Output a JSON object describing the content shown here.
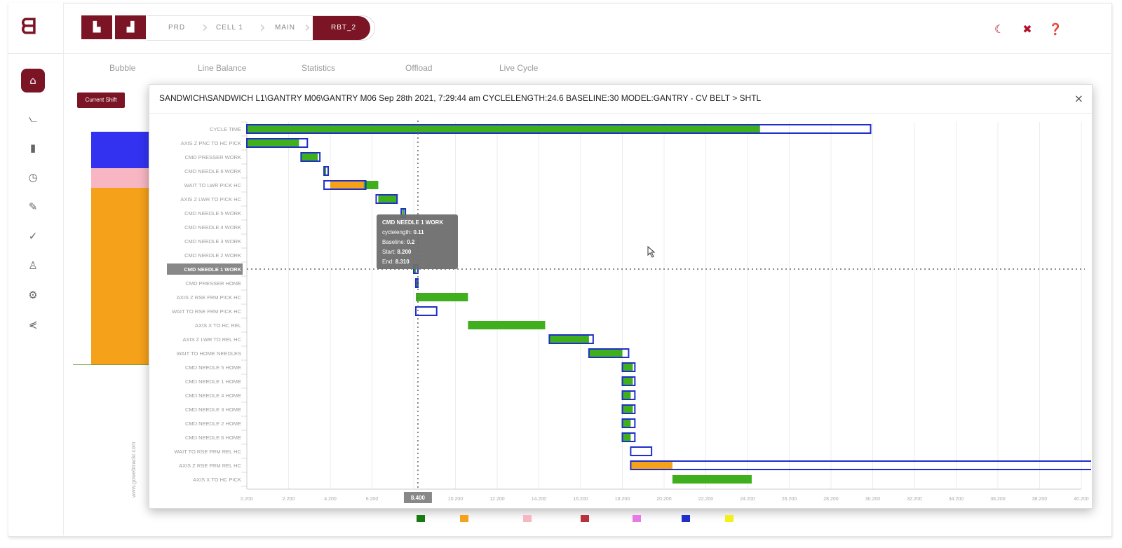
{
  "breadcrumb": {
    "items": [
      "PRD",
      "CELL 1",
      "MAIN",
      "RBT_2"
    ]
  },
  "toolbar": {
    "btn1_icon": "factory-icon",
    "btn2_icon": "chart-bar-icon"
  },
  "top_icons": [
    "moon-icon",
    "fullscreen-icon",
    "help-icon"
  ],
  "tabs": [
    "Bubble",
    "Line Balance",
    "Statistics",
    "Offload",
    "Live Cycle"
  ],
  "current_shift_label": "Current Shift",
  "side_icons": [
    "home-icon",
    "rss-icon",
    "signal-icon",
    "clock-icon",
    "edit-icon",
    "check-circle-icon",
    "user-icon",
    "settings-icon",
    "share-icon"
  ],
  "background_chart": {
    "vertical_label": "www.gowebtrackr.com"
  },
  "modal": {
    "title": "SANDWICH\\SANDWICH L1\\GANTRY M06\\GANTRY M06 Sep 28th 2021, 7:29:44 am CYCLELENGTH:24.6 BASELINE:30 MODEL:GANTRY - CV BELT > SHTL",
    "close": "×"
  },
  "tooltip": {
    "title": "CMD NEEDLE 1 WORK",
    "lines": [
      "cyclelength: 0.11",
      "Baseline: 0.2",
      "Start: 8.200",
      "End: 8.310"
    ]
  },
  "colors": {
    "green": "#3faf1e",
    "orange": "#f5a11a",
    "blue": "#1f2fc8",
    "pink": "#f7b6c2",
    "brown": "#b8323e",
    "violet": "#e57ae4",
    "yellow": "#f5f01a",
    "darkgreen": "#1a7a12",
    "brand": "#7b1424"
  },
  "legend_colors": [
    "#1a7a12",
    "#f5a11a",
    "#f7b6c2",
    "#b8323e",
    "#e57ae4",
    "#1f2fc8",
    "#f5f01a"
  ],
  "chart_data": {
    "type": "gantt",
    "title": "",
    "xlim": [
      0.2,
      40.2
    ],
    "x_ticks": [
      "0.200",
      "2.200",
      "4.200",
      "6.200",
      "8.200",
      "10.200",
      "12.200",
      "14.200",
      "16.200",
      "18.200",
      "20.200",
      "22.200",
      "24.200",
      "26.200",
      "28.200",
      "30.200",
      "32.200",
      "34.200",
      "36.200",
      "38.200",
      "40.200"
    ],
    "crosshair_x_label": "8.400",
    "crosshair_category": "CMD NEEDLE 1 WORK",
    "categories": [
      "CYCLE TIME",
      "AXIS Z PNC TO HC PICK",
      "CMD PRESSER WORK",
      "CMD NEEDLE 6 WORK",
      "WAIT TO LWR PICK HC",
      "AXIS Z LWR TO PICK HC",
      "CMD NEEDLE 5 WORK",
      "CMD NEEDLE 4 WORK",
      "CMD NEEDLE 3 WORK",
      "CMD NEEDLE 2 WORK",
      "CMD NEEDLE 1 WORK",
      "CMD PRESSER HOME",
      "AXIS Z RSE FRM PICK HC",
      "WAIT TO RSE FRM PICK HC",
      "AXIS X TO HC REL",
      "AXIS Z LWR TO REL HC",
      "WAIT TO HOME NEEDLES",
      "CMD NEEDLE 5 HOME",
      "CMD NEEDLE 1 HOME",
      "CMD NEEDLE 4 HOME",
      "CMD NEEDLE 3 HOME",
      "CMD NEEDLE 2 HOME",
      "CMD NEEDLE 6 HOME",
      "WAIT TO RSE FRM REL HC",
      "AXIS Z RSE FRM REL HC",
      "AXIS X TO HC PICK"
    ],
    "series": [
      {
        "name": "cyclelength",
        "color": "green",
        "bars": [
          [
            0,
            0.2,
            24.8
          ],
          [
            1,
            0.2,
            2.7
          ],
          [
            2,
            2.8,
            3.6
          ],
          [
            3,
            3.9,
            4.0
          ],
          [
            4,
            4.2,
            5.8
          ],
          [
            4,
            5.8,
            6.5
          ],
          [
            5,
            6.5,
            7.4
          ],
          [
            6,
            7.65,
            7.75
          ],
          [
            10,
            8.2,
            8.31
          ],
          [
            11,
            8.3,
            8.35
          ],
          [
            12,
            8.3,
            10.8
          ],
          [
            14,
            10.8,
            14.5
          ],
          [
            15,
            14.7,
            16.6
          ],
          [
            16,
            16.6,
            18.2
          ],
          [
            17,
            18.2,
            18.7
          ],
          [
            18,
            18.2,
            18.7
          ],
          [
            19,
            18.2,
            18.6
          ],
          [
            20,
            18.2,
            18.7
          ],
          [
            21,
            18.2,
            18.6
          ],
          [
            22,
            18.2,
            18.6
          ],
          [
            24,
            18.6,
            20.6
          ],
          [
            25,
            20.6,
            24.4
          ]
        ]
      },
      {
        "name": "Baseline",
        "color": "blue",
        "bars": [
          [
            0,
            0.2,
            30.1
          ],
          [
            1,
            0.2,
            3.1
          ],
          [
            2,
            2.8,
            3.7
          ],
          [
            3,
            3.9,
            4.1
          ],
          [
            4,
            3.9,
            5.9
          ],
          [
            5,
            6.4,
            7.4
          ],
          [
            6,
            7.6,
            7.8
          ],
          [
            10,
            8.2,
            8.4
          ],
          [
            11,
            8.3,
            8.4
          ],
          [
            13,
            8.3,
            9.3
          ],
          [
            15,
            14.7,
            16.8
          ],
          [
            16,
            16.6,
            18.5
          ],
          [
            17,
            18.2,
            18.8
          ],
          [
            18,
            18.2,
            18.8
          ],
          [
            19,
            18.2,
            18.8
          ],
          [
            20,
            18.2,
            18.8
          ],
          [
            21,
            18.2,
            18.8
          ],
          [
            22,
            18.2,
            18.8
          ],
          [
            23,
            18.6,
            19.6
          ],
          [
            24,
            18.6,
            40.7
          ]
        ]
      }
    ]
  }
}
